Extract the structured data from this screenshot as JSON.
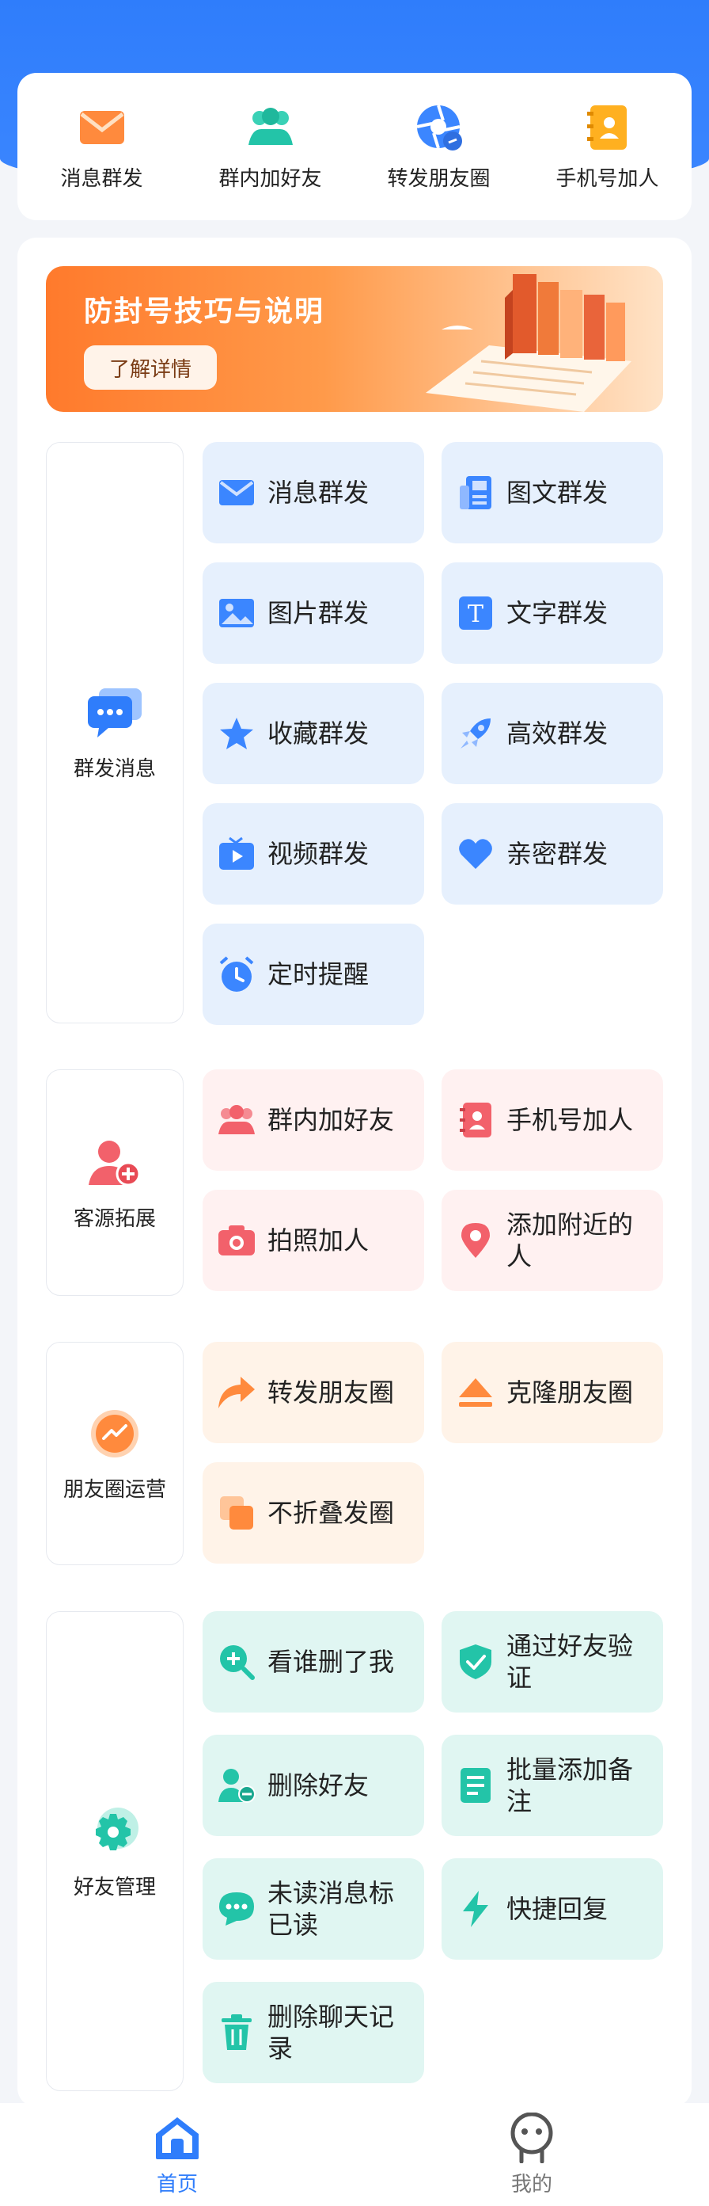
{
  "shortcuts": [
    {
      "label": "消息群发",
      "icon": "envelope-icon"
    },
    {
      "label": "群内加好友",
      "icon": "group-icon"
    },
    {
      "label": "转发朋友圈",
      "icon": "aperture-icon"
    },
    {
      "label": "手机号加人",
      "icon": "contact-book-icon"
    }
  ],
  "banner": {
    "title": "防封号技巧与说明",
    "button": "了解详情"
  },
  "sections": {
    "mass_message": {
      "label": "群发消息",
      "items": [
        "消息群发",
        "图文群发",
        "图片群发",
        "文字群发",
        "收藏群发",
        "高效群发",
        "视频群发",
        "亲密群发",
        "定时提醒"
      ]
    },
    "customer": {
      "label": "客源拓展",
      "items": [
        "群内加好友",
        "手机号加人",
        "拍照加人",
        "添加附近的人"
      ]
    },
    "moments": {
      "label": "朋友圈运营",
      "items": [
        "转发朋友圈",
        "克隆朋友圈",
        "不折叠发圈"
      ]
    },
    "friends": {
      "label": "好友管理",
      "items": [
        "看谁删了我",
        "通过好友验证",
        "删除好友",
        "批量添加备注",
        "未读消息标已读",
        "快捷回复",
        "删除聊天记录"
      ]
    }
  },
  "tabbar": {
    "home": "首页",
    "mine": "我的"
  },
  "colors": {
    "primary": "#2f7dfb",
    "accent_orange": "#ff7a2c",
    "teal": "#23c4a8",
    "pink": "#f2616b"
  }
}
